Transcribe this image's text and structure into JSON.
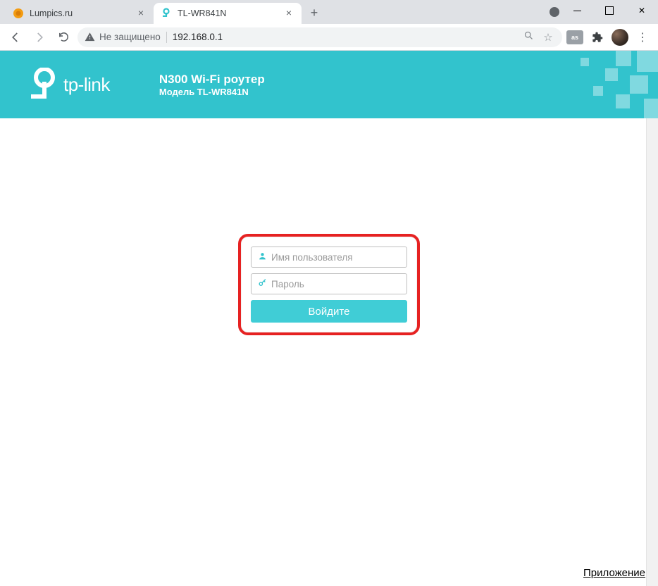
{
  "browser": {
    "tabs": [
      {
        "title": "Lumpics.ru",
        "active": false
      },
      {
        "title": "TL-WR841N",
        "active": true
      }
    ],
    "security_label": "Не защищено",
    "url": "192.168.0.1"
  },
  "header": {
    "brand": "tp-link",
    "title": "N300 Wi-Fi роутер",
    "model": "Модель TL-WR841N"
  },
  "login": {
    "username_placeholder": "Имя пользователя",
    "password_placeholder": "Пароль",
    "button": "Войдите"
  },
  "footer": {
    "link": "Приложение"
  }
}
